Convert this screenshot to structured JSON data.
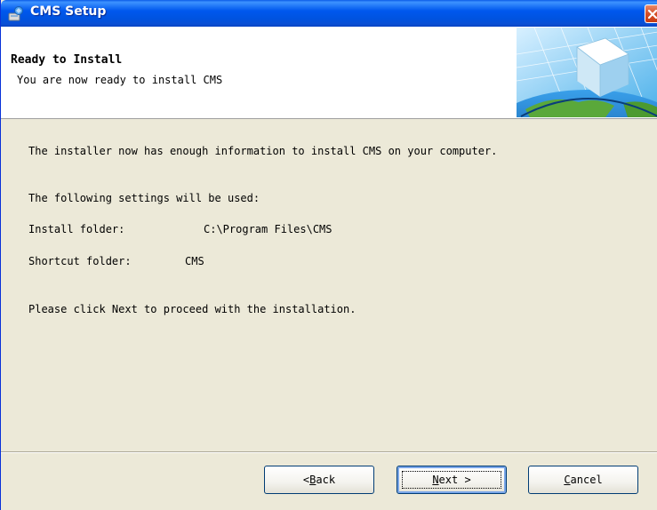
{
  "window": {
    "title": "CMS Setup",
    "icon": "setup-installer-icon",
    "close_icon": "close-icon"
  },
  "header": {
    "title": "Ready to Install",
    "subtitle": "You are now ready to install CMS",
    "art": "globe-cube-banner"
  },
  "body": {
    "intro": "The installer now has enough information to install CMS on your computer.",
    "settings_heading": "The following settings will be used:",
    "install_folder_label": "Install folder:",
    "install_folder_value": "C:\\Program Files\\CMS",
    "shortcut_folder_label": "Shortcut folder:",
    "shortcut_folder_value": "CMS",
    "instruction": "Please click Next to proceed with the installation."
  },
  "buttons": {
    "back": {
      "prefix": "< ",
      "accel": "B",
      "rest": "ack"
    },
    "next": {
      "accel": "N",
      "rest": "ext >"
    },
    "cancel": {
      "accel": "C",
      "rest": "ancel"
    }
  },
  "colors": {
    "titlebar": "#0058ee",
    "dialog_bg": "#ece9d8",
    "close_button": "#d54f28"
  }
}
